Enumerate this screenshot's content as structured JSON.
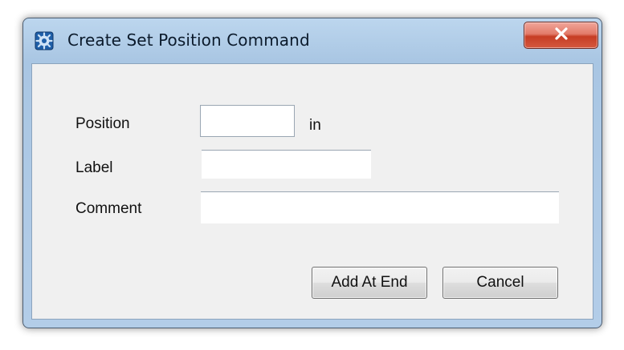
{
  "window": {
    "title": "Create Set Position Command",
    "close_icon": "close-icon",
    "app_icon": "gear-icon"
  },
  "form": {
    "position": {
      "label": "Position",
      "value": "",
      "unit": "in"
    },
    "label": {
      "label": "Label",
      "value": ""
    },
    "comment": {
      "label": "Comment",
      "value": ""
    }
  },
  "buttons": {
    "add_at_end": "Add At End",
    "cancel": "Cancel"
  },
  "colors": {
    "title_bar": "#b3cde8",
    "close_button": "#d5583f",
    "client_background": "#f0f0f0"
  }
}
